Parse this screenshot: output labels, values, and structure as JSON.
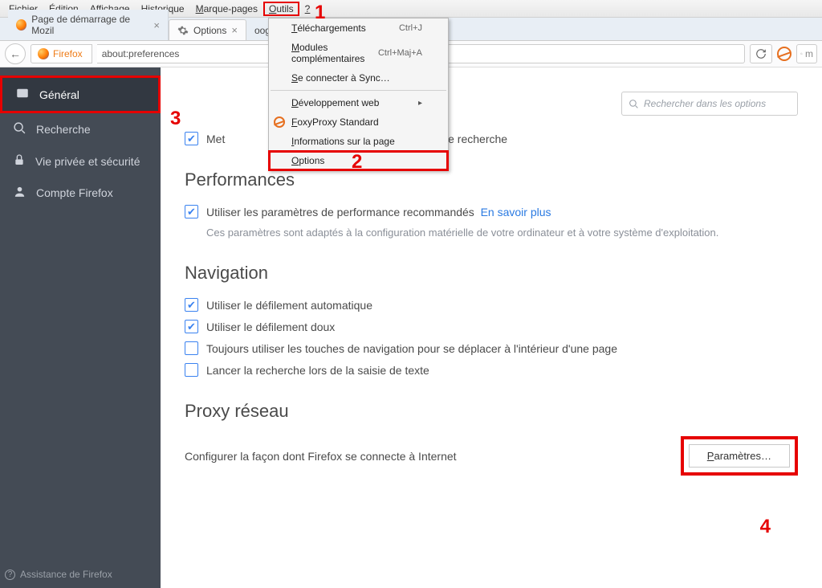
{
  "menubar": [
    "Fichier",
    "Édition",
    "Affichage",
    "Historique",
    "Marque-pages",
    "Outils",
    "?"
  ],
  "menubar_highlight_index": 5,
  "tabs": [
    {
      "label": "Page de démarrage de Mozil",
      "icon": "firefox",
      "active": false
    },
    {
      "label": "Options",
      "icon": "gear",
      "active": true
    },
    {
      "label": "oogle",
      "icon": "",
      "active": false
    }
  ],
  "urlbar": {
    "identity_name": "Firefox",
    "value": "about:preferences",
    "search_hint": "m"
  },
  "sidebar": {
    "items": [
      {
        "label": "Général",
        "icon": "general",
        "active": true,
        "highlight": true
      },
      {
        "label": "Recherche",
        "icon": "search",
        "active": false
      },
      {
        "label": "Vie privée et sécurité",
        "icon": "lock",
        "active": false
      },
      {
        "label": "Compte Firefox",
        "icon": "person",
        "active": false
      }
    ],
    "footer": "Assistance de Firefox"
  },
  "options_search_placeholder": "Rechercher dans les options",
  "top_check_label": "Met",
  "top_check_tail": "de recherche",
  "sections": {
    "perf": {
      "title": "Performances",
      "check_label": "Utiliser les paramètres de performance recommandés",
      "learn_more": "En savoir plus",
      "note": "Ces paramètres sont adaptés à la configuration matérielle de votre ordinateur et à votre système d'exploitation."
    },
    "nav": {
      "title": "Navigation",
      "items": [
        {
          "checked": true,
          "label": "Utiliser le défilement automatique"
        },
        {
          "checked": true,
          "label": "Utiliser le défilement doux"
        },
        {
          "checked": false,
          "label": "Toujours utiliser les touches de navigation pour se déplacer à l'intérieur d'une page"
        },
        {
          "checked": false,
          "label": "Lancer la recherche lors de la saisie de texte"
        }
      ]
    },
    "proxy": {
      "title": "Proxy réseau",
      "desc": "Configurer la façon dont Firefox se connecte à Internet",
      "button": "Paramètres…"
    }
  },
  "dropdown": {
    "items": [
      {
        "label": "Téléchargements",
        "shortcut": "Ctrl+J"
      },
      {
        "label": "Modules complémentaires",
        "shortcut": "Ctrl+Maj+A"
      },
      {
        "label": "Se connecter à Sync…"
      },
      {
        "sep": true
      },
      {
        "label": "Développement web",
        "submenu": true
      },
      {
        "label": "FoxyProxy Standard",
        "fpicon": true
      },
      {
        "label": "Informations sur la page"
      },
      {
        "label": "Options",
        "highlight": true
      }
    ]
  },
  "annotations": {
    "1": "1",
    "2": "2",
    "3": "3",
    "4": "4"
  }
}
